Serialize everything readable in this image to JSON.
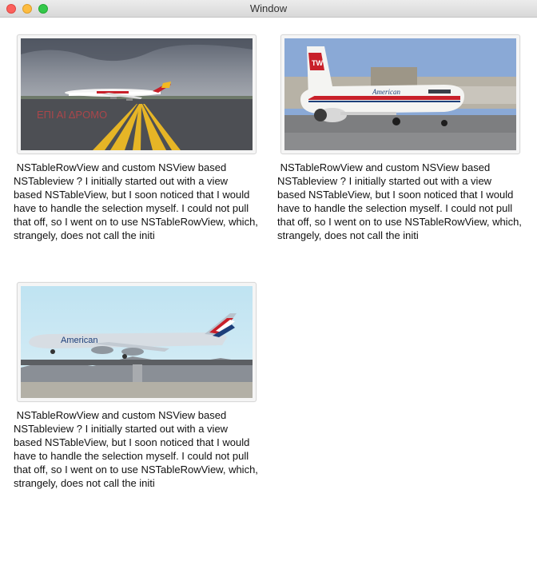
{
  "window": {
    "title": "Window"
  },
  "items": [
    {
      "image": "airplane-iberia-photo",
      "caption": " NSTableRowView and custom NSView based NSTableview ? I initially started out with a view based NSTableView, but I soon noticed that I would have to handle the selection myself. I could not pull that off, so I went on to use NSTableRowView, which, strangely, does not call the initi"
    },
    {
      "image": "airplane-american-retro-photo",
      "caption": " NSTableRowView and custom NSView based NSTableview ? I initially started out with a view based NSTableView, but I soon noticed that I would have to handle the selection myself. I could not pull that off, so I went on to use NSTableRowView, which, strangely, does not call the initi"
    },
    {
      "image": "airplane-american-landing-photo",
      "caption": " NSTableRowView and custom NSView based NSTableview ? I initially started out with a view based NSTableView, but I soon noticed that I would have to handle the selection myself. I could not pull that off, so I went on to use NSTableRowView, which, strangely, does not call the initi"
    }
  ]
}
